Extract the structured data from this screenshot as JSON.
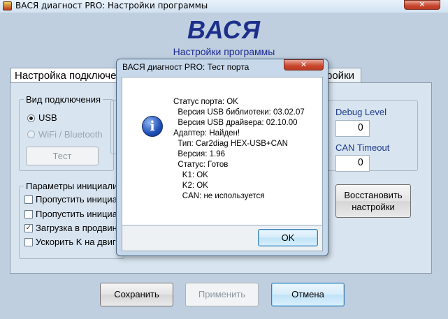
{
  "main_window": {
    "title": "ВАСЯ диагност PRO:  Настройки программы",
    "close_glyph": "✕",
    "app_heading": "ВАСЯ",
    "app_subtitle": "Настройки программы"
  },
  "tabs": [
    {
      "label": "Настройка подключе",
      "active": true
    },
    {
      "label": "ройки",
      "active": false
    }
  ],
  "connection_group": {
    "legend": "Вид подключения",
    "options": [
      {
        "label": "USB",
        "selected": true,
        "enabled": true
      },
      {
        "label": "WiFi / Bluetooth",
        "selected": false,
        "enabled": false
      }
    ],
    "test_button": "Тест"
  },
  "init_group": {
    "legend": "Параметры инициализ",
    "checks": [
      {
        "label": "Пропустить инициал",
        "checked": false
      },
      {
        "label": "Пропустить инициал",
        "checked": false
      },
      {
        "label": "Загрузка в продвин",
        "checked": true
      },
      {
        "label": "Ускорить K на двиг",
        "checked": false
      }
    ]
  },
  "right_panel": {
    "debug_level_label": "Debug Level",
    "debug_level_value": "0",
    "can_timeout_label": "CAN Timeout",
    "can_timeout_value": "0",
    "restore_button_line1": "Восстановить",
    "restore_button_line2": "настройки"
  },
  "bottom_buttons": {
    "save": "Сохранить",
    "apply": "Применить",
    "cancel": "Отмена"
  },
  "dialog": {
    "title": "ВАСЯ диагност PRO: Тест порта",
    "close_glyph": "✕",
    "icon": "info-icon",
    "lines": [
      "Статус порта: OK",
      "  Версия USB библиотеки: 03.02.07",
      "  Версия USB драйвера: 02.10.00",
      "Адаптер: Найден!",
      "  Тип: Car2diag HEX-USB+CAN",
      "  Версия: 1.96",
      "  Статус: Готов",
      "    K1: OK",
      "    K2: OK",
      "    CAN: не используется"
    ],
    "ok_button": "OK"
  }
}
